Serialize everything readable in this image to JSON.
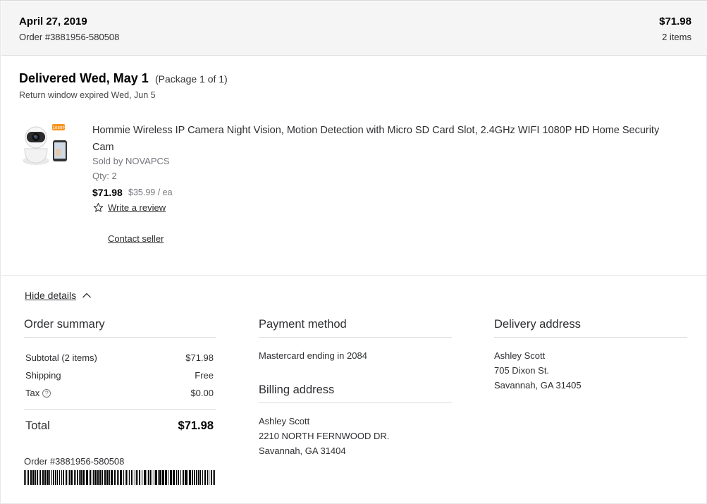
{
  "header": {
    "date": "April 27, 2019",
    "order_number": "Order #3881956-580508",
    "total": "$71.98",
    "items": "2 items"
  },
  "delivery": {
    "status": "Delivered Wed, May 1",
    "package": "(Package 1 of 1)",
    "return_window": "Return window expired Wed, Jun 5"
  },
  "product": {
    "title": "Hommie Wireless IP Camera Night Vision, Motion Detection with Micro SD Card Slot, 2.4GHz WIFI 1080P HD Home Security Cam",
    "seller": "Sold by NOVAPCS",
    "qty": "Qty: 2",
    "price": "$71.98",
    "unit_price": "$35.99 / ea",
    "write_review": "Write a review",
    "contact_seller": "Contact seller",
    "thumb_badge": "1080P"
  },
  "details_toggle": "Hide details",
  "order_summary": {
    "heading": "Order summary",
    "rows": [
      {
        "label": "Subtotal (2 items)",
        "value": "$71.98"
      },
      {
        "label": "Shipping",
        "value": "Free"
      },
      {
        "label": "Tax",
        "value": "$0.00",
        "info_icon": "?"
      }
    ],
    "total_label": "Total",
    "total_value": "$71.98",
    "order_number": "Order #3881956-580508"
  },
  "payment": {
    "heading": "Payment method",
    "method": "Mastercard ending in 2084"
  },
  "billing": {
    "heading": "Billing address",
    "name": "Ashley Scott",
    "line1": "2210 NORTH FERNWOOD DR.",
    "line2": "Savannah, GA 31404"
  },
  "shipping_address": {
    "heading": "Delivery address",
    "name": "Ashley Scott",
    "line1": "705 Dixon St.",
    "line2": "Savannah, GA 31405"
  },
  "icons": {
    "star": "star-outline-icon",
    "chevron": "chevron-up-icon",
    "info": "info-circle-icon"
  },
  "colors": {
    "header_bg": "#f5f5f5",
    "text": "#2e2f32",
    "muted": "#74767c",
    "badge": "#f7941d"
  }
}
